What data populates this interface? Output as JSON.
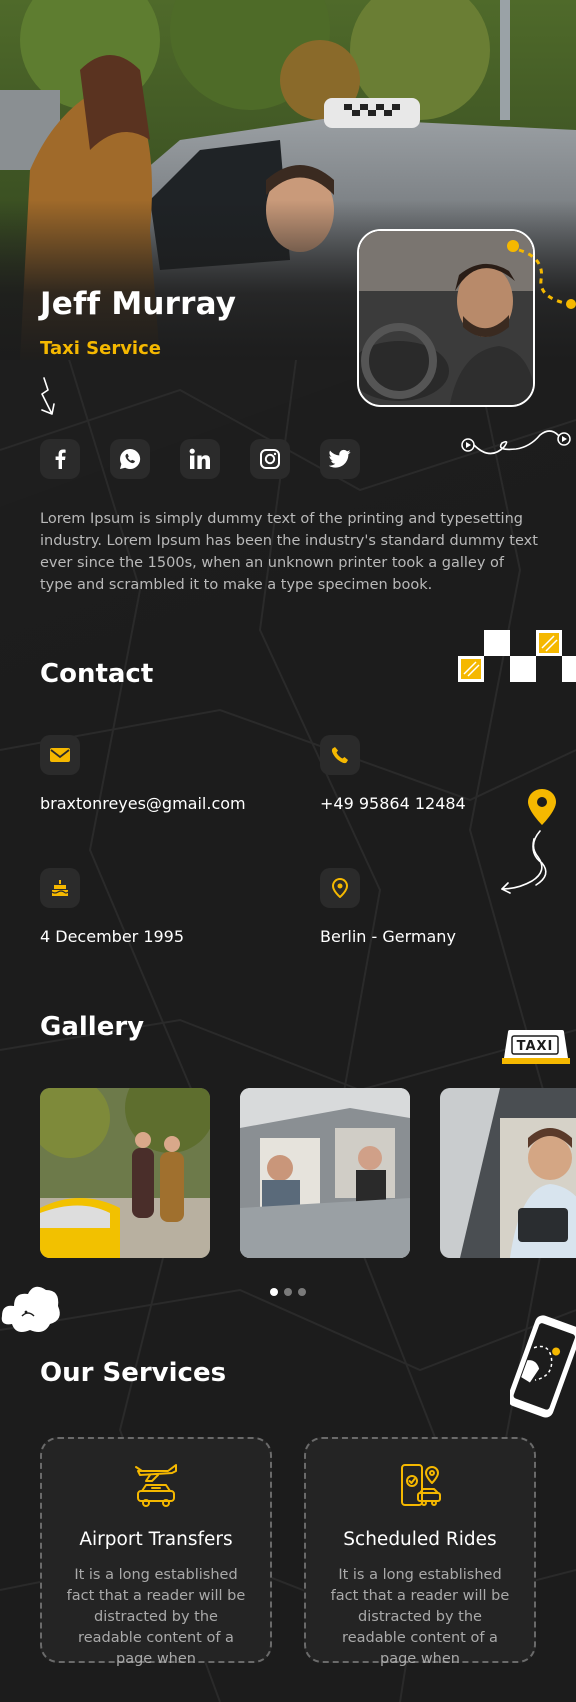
{
  "profile": {
    "name": "Jeff Murray",
    "role": "Taxi Service",
    "bio": "Lorem Ipsum is simply dummy text of the printing and typesetting industry. Lorem Ipsum has been the industry's standard dummy text ever since the 1500s, when an unknown printer took a galley of type and scrambled it to make a type specimen book."
  },
  "socials": [
    {
      "name": "facebook",
      "icon": "facebook-icon"
    },
    {
      "name": "whatsapp",
      "icon": "whatsapp-icon"
    },
    {
      "name": "linkedin",
      "icon": "linkedin-icon"
    },
    {
      "name": "instagram",
      "icon": "instagram-icon"
    },
    {
      "name": "twitter",
      "icon": "twitter-icon"
    }
  ],
  "contact": {
    "title": "Contact",
    "email": "braxtonreyes@gmail.com",
    "phone": "+49 95864 12484",
    "birthday": "4 December 1995",
    "location": "Berlin - Germany"
  },
  "gallery": {
    "title": "Gallery",
    "taxi_sign": "TAXI",
    "page_count": 3,
    "active_page": 1
  },
  "services": {
    "title": "Our Services",
    "items": [
      {
        "title": "Airport Transfers",
        "description": "It is a long established fact that a reader will be distracted by the readable content of a page when",
        "icon": "airport-transfer-icon"
      },
      {
        "title": "Scheduled Rides",
        "description": "It is a long established fact that a reader will be distracted by the readable content of a page when",
        "icon": "scheduled-ride-icon"
      }
    ]
  },
  "colors": {
    "accent": "#f5b800",
    "background": "#1c1c1c",
    "card": "#2b2b2b"
  }
}
